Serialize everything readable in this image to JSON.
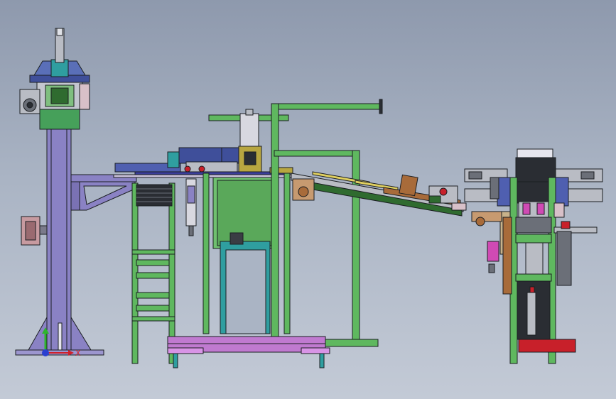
{
  "view": {
    "background_top": "#8e99ad",
    "background_bottom": "#c3cad6"
  },
  "colors": {
    "green_frame": "#5fb85f",
    "column_purple": "#8a82c4",
    "navy_blue": "#3f4f9a",
    "teal": "#2f9ea0",
    "magenta_base": "#c07ad0",
    "olive_yellow": "#b8a640",
    "dark_green": "#2f6b2f",
    "brown": "#a86b3a",
    "red": "#c8202a",
    "steel_grey": "#b9bcc4"
  },
  "axes": {
    "x_label": "X",
    "x_color": "#d0202a",
    "y_color": "#2fb42f",
    "origin_color": "#2a3fd0"
  }
}
